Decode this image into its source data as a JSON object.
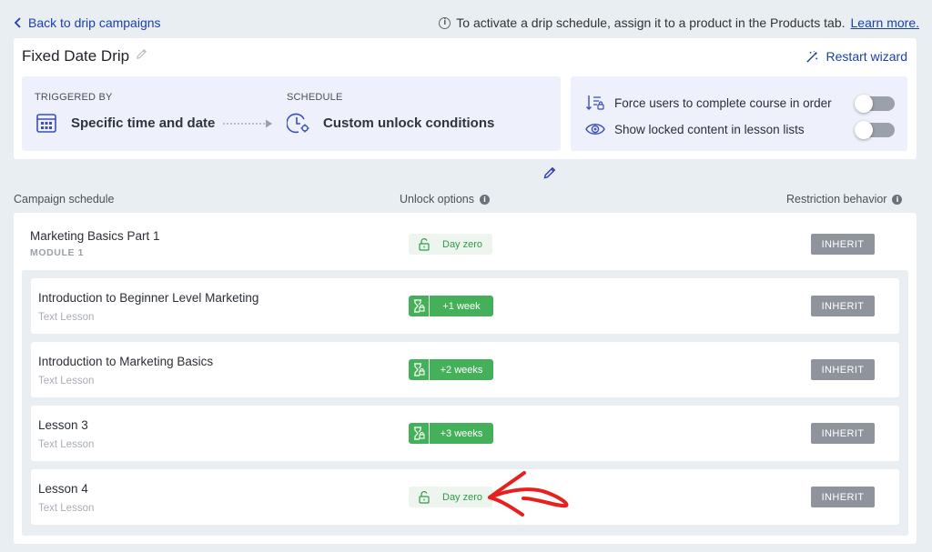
{
  "topbar": {
    "back_label": "Back to drip campaigns",
    "info_text": "To activate a drip schedule, assign it to a product in the Products tab.",
    "learn_more": "Learn more."
  },
  "header": {
    "title": "Fixed Date Drip",
    "restart_label": "Restart wizard"
  },
  "trigger": {
    "triggered_by_label": "TRIGGERED BY",
    "triggered_by_value": "Specific time and date",
    "schedule_label": "SCHEDULE",
    "schedule_value": "Custom unlock conditions"
  },
  "toggles": [
    {
      "label": "Force users to complete course in order",
      "enabled": false
    },
    {
      "label": "Show locked content in lesson lists",
      "enabled": false
    }
  ],
  "columns": {
    "campaign": "Campaign schedule",
    "unlock": "Unlock options",
    "restriction": "Restriction behavior"
  },
  "module": {
    "title": "Marketing Basics Part 1",
    "subtitle": "MODULE 1",
    "unlock": "Day zero",
    "restriction": "INHERIT"
  },
  "lessons": [
    {
      "title": "Introduction to Beginner Level Marketing",
      "type": "Text Lesson",
      "unlock": "+1 week",
      "restriction": "INHERIT"
    },
    {
      "title": "Introduction to Marketing Basics",
      "type": "Text Lesson",
      "unlock": "+2 weeks",
      "restriction": "INHERIT"
    },
    {
      "title": "Lesson 3",
      "type": "Text Lesson",
      "unlock": "+3 weeks",
      "restriction": "INHERIT"
    },
    {
      "title": "Lesson 4",
      "type": "Text Lesson",
      "unlock": "Day zero",
      "restriction": "INHERIT"
    }
  ],
  "colors": {
    "link": "#1a3fb0",
    "unlock_green": "#44b15a",
    "inherit_gray": "#8f949c",
    "panel_tint": "#eef0fb",
    "annotation_red": "#e8201d"
  }
}
